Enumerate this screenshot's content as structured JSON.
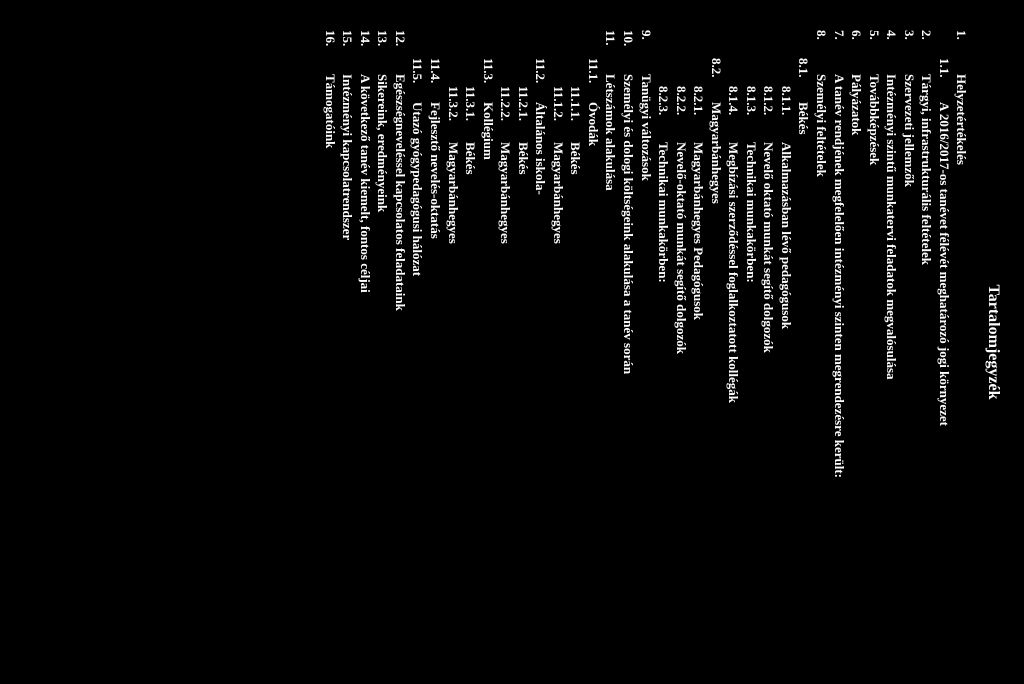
{
  "title": "Tartalomjegyzék",
  "items": [
    {
      "lvl": 1,
      "num": "1.",
      "text": "Helyzetértékelés"
    },
    {
      "lvl": 2,
      "num": "1.1.",
      "text": "A 2016/2017-os tanévet félévét meghatározó jogi környezet"
    },
    {
      "lvl": 1,
      "num": "2.",
      "text": "Tárgyi, infrastrukturális feltételek"
    },
    {
      "lvl": 1,
      "num": "3.",
      "text": "Szervezeti jellemzők"
    },
    {
      "lvl": 1,
      "num": "4.",
      "text": "Intézményi szintű munkatervi feladatok megvalósulása"
    },
    {
      "lvl": 1,
      "num": "5.",
      "text": "Továbbképzések"
    },
    {
      "lvl": 1,
      "num": "6.",
      "text": "Pályázatok"
    },
    {
      "lvl": 1,
      "num": "7.",
      "text": "A tanév rendjének megfelelően intézményi szinten megrendezésre került:"
    },
    {
      "lvl": 1,
      "num": "8.",
      "text": "Személyi feltételek"
    },
    {
      "lvl": 2,
      "num": "8.1.",
      "text": "Békés"
    },
    {
      "lvl": 3,
      "num": "8.1.1.",
      "text": "Alkalmazásban lévő pedagógusok"
    },
    {
      "lvl": 3,
      "num": "8.1.2.",
      "text": "Nevelő oktató munkát segítő dolgozók"
    },
    {
      "lvl": 3,
      "num": "8.1.3.",
      "text": "Technikai munkakörben:"
    },
    {
      "lvl": 3,
      "num": "8.1.4.",
      "text": "Megbízási szerződéssel foglalkoztatott kollégák"
    },
    {
      "lvl": 2,
      "num": "8.2.",
      "text": "Magyarbánhegyes"
    },
    {
      "lvl": 3,
      "num": "8.2.1.",
      "text": "Magyarbánhegyes Pedagógusok"
    },
    {
      "lvl": 3,
      "num": "8.2.2.",
      "text": "Nevelő-oktató munkát segítő dolgozók"
    },
    {
      "lvl": 3,
      "num": "8.2.3.",
      "text": "Technikai munkakörben:"
    },
    {
      "lvl": 1,
      "num": "9.",
      "text": "Tanügyi változások"
    },
    {
      "lvl": 1,
      "num": "10.",
      "text": "Személyi és dologi költségeink alakulása a tanév során"
    },
    {
      "lvl": 1,
      "num": "11.",
      "text": "Létszámok alakulása"
    },
    {
      "lvl": 2,
      "num": "11.1.",
      "text": "Óvodák"
    },
    {
      "lvl": 3,
      "num": "11.1.1.",
      "text": "Békés"
    },
    {
      "lvl": 3,
      "num": "11.1.2.",
      "text": "Magyarbánhegyes"
    },
    {
      "lvl": 2,
      "num": "11.2.",
      "text": "Általános iskola-"
    },
    {
      "lvl": 3,
      "num": "11.2.1.",
      "text": "Békés"
    },
    {
      "lvl": 3,
      "num": "11.2.2.",
      "text": "Magyarbánhegyes"
    },
    {
      "lvl": 2,
      "num": "11.3.",
      "text": "Kollégium"
    },
    {
      "lvl": 3,
      "num": "11.3.1.",
      "text": "Békés"
    },
    {
      "lvl": 3,
      "num": "11.3.2.",
      "text": "Magyarbánhegyes"
    },
    {
      "lvl": 2,
      "num": "11.4.",
      "text": "Fejlesztő nevelés-oktatás"
    },
    {
      "lvl": 2,
      "num": "11.5.",
      "text": "Utazó gyógypedagógusi hálózat"
    },
    {
      "lvl": 1,
      "num": "12.",
      "text": "Egészségneveléssel kapcsolatos feladataink"
    },
    {
      "lvl": 1,
      "num": "13.",
      "text": "Sikereink, eredményeink"
    },
    {
      "lvl": 1,
      "num": "14.",
      "text": "A következő tanév kiemelt, fontos céljai"
    },
    {
      "lvl": 1,
      "num": "15.",
      "text": "Intézményi kapcsolatrendszer"
    },
    {
      "lvl": 1,
      "num": "16.",
      "text": "Támogatóink"
    }
  ]
}
